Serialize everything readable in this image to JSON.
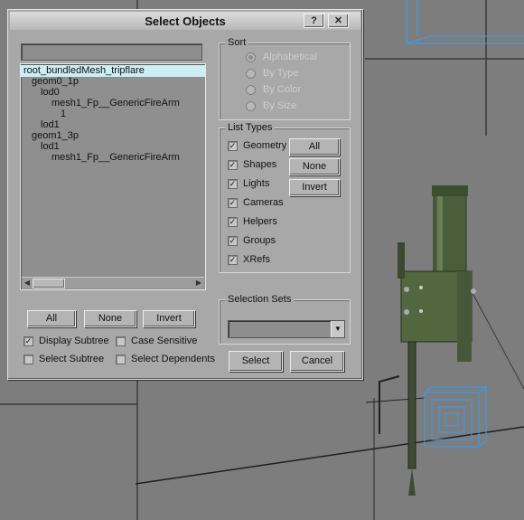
{
  "dialog": {
    "title": "Select Objects",
    "help_button": "?",
    "close_button": "✕",
    "search_value": "",
    "tree": [
      {
        "label": "root_bundledMesh_tripflare",
        "indent": 0,
        "selected": true
      },
      {
        "label": "geom0_1p",
        "indent": 1
      },
      {
        "label": "lod0",
        "indent": 2
      },
      {
        "label": "mesh1_Fp__GenericFireArm",
        "indent": 3
      },
      {
        "label": "1",
        "indent": 4
      },
      {
        "label": "lod1",
        "indent": 2
      },
      {
        "label": "geom1_3p",
        "indent": 1
      },
      {
        "label": "lod1",
        "indent": 2
      },
      {
        "label": "mesh1_Fp__GenericFireArm",
        "indent": 3
      }
    ],
    "list_buttons": {
      "all": "All",
      "none": "None",
      "invert": "Invert"
    },
    "options": {
      "display_subtree": {
        "label": "Display Subtree",
        "checked": true
      },
      "case_sensitive": {
        "label": "Case Sensitive",
        "checked": false
      },
      "select_subtree": {
        "label": "Select Subtree",
        "checked": false
      },
      "select_dependents": {
        "label": "Select Dependents",
        "checked": false
      }
    },
    "sort": {
      "label": "Sort",
      "options": [
        "Alphabetical",
        "By Type",
        "By Color",
        "By Size"
      ],
      "selected": "Alphabetical"
    },
    "list_types": {
      "label": "List Types",
      "items": [
        {
          "label": "Geometry",
          "checked": true
        },
        {
          "label": "Shapes",
          "checked": true
        },
        {
          "label": "Lights",
          "checked": true
        },
        {
          "label": "Cameras",
          "checked": true
        },
        {
          "label": "Helpers",
          "checked": true
        },
        {
          "label": "Groups",
          "checked": true
        },
        {
          "label": "XRefs",
          "checked": true
        }
      ],
      "buttons": {
        "all": "All",
        "none": "None",
        "invert": "Invert"
      }
    },
    "selection_sets": {
      "label": "Selection Sets",
      "value": ""
    },
    "select_button": "Select",
    "cancel_button": "Cancel"
  },
  "colors": {
    "viewport_bg": "#7d7d7d",
    "dialog_bg": "#a8a8a8",
    "list_bg": "#8f8f8f",
    "selected_row": "#cdeef2",
    "helper_blue": "#2ea0ff",
    "object_green": "#4b5e3c"
  }
}
